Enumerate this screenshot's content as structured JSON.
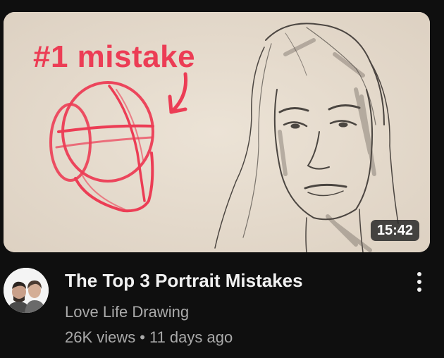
{
  "thumbnail": {
    "overlay_title": "#1 mistake",
    "duration": "15:42",
    "accent_color": "#ec3d55"
  },
  "video": {
    "title": "The Top 3 Portrait Mistakes",
    "channel": "Love Life Drawing",
    "views": "26K views",
    "separator": "•",
    "age": "11 days ago"
  },
  "icons": {
    "menu": "vertical-dots-icon",
    "arrow": "curved-arrow-icon"
  },
  "colors": {
    "background": "#0f0f0f",
    "title_text": "#f1f1f1",
    "secondary_text": "#aaaaaa"
  }
}
